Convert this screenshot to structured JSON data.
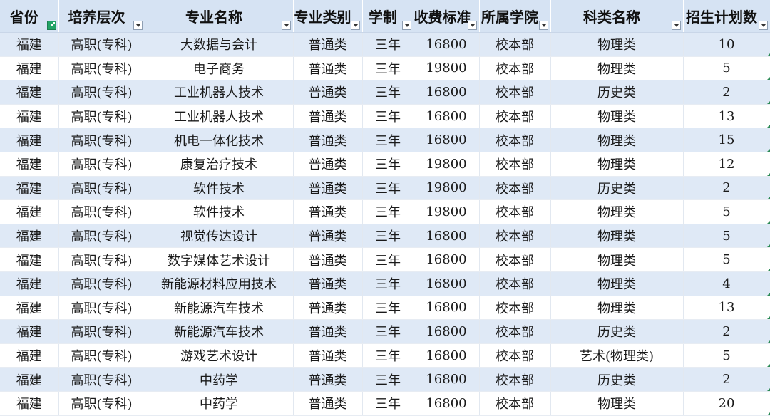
{
  "headers": [
    "省份",
    "培养层次",
    "专业名称",
    "专业类别",
    "学制",
    "收费标准",
    "所属学院",
    "科类名称",
    "招生计划数"
  ],
  "rows": [
    [
      "福建",
      "高职(专科)",
      "大数据与会计",
      "普通类",
      "三年",
      "16800",
      "校本部",
      "物理类",
      "10"
    ],
    [
      "福建",
      "高职(专科)",
      "电子商务",
      "普通类",
      "三年",
      "19800",
      "校本部",
      "物理类",
      "5"
    ],
    [
      "福建",
      "高职(专科)",
      "工业机器人技术",
      "普通类",
      "三年",
      "16800",
      "校本部",
      "历史类",
      "2"
    ],
    [
      "福建",
      "高职(专科)",
      "工业机器人技术",
      "普通类",
      "三年",
      "16800",
      "校本部",
      "物理类",
      "13"
    ],
    [
      "福建",
      "高职(专科)",
      "机电一体化技术",
      "普通类",
      "三年",
      "16800",
      "校本部",
      "物理类",
      "15"
    ],
    [
      "福建",
      "高职(专科)",
      "康复治疗技术",
      "普通类",
      "三年",
      "19800",
      "校本部",
      "物理类",
      "12"
    ],
    [
      "福建",
      "高职(专科)",
      "软件技术",
      "普通类",
      "三年",
      "19800",
      "校本部",
      "历史类",
      "2"
    ],
    [
      "福建",
      "高职(专科)",
      "软件技术",
      "普通类",
      "三年",
      "19800",
      "校本部",
      "物理类",
      "5"
    ],
    [
      "福建",
      "高职(专科)",
      "视觉传达设计",
      "普通类",
      "三年",
      "16800",
      "校本部",
      "物理类",
      "5"
    ],
    [
      "福建",
      "高职(专科)",
      "数字媒体艺术设计",
      "普通类",
      "三年",
      "16800",
      "校本部",
      "物理类",
      "5"
    ],
    [
      "福建",
      "高职(专科)",
      "新能源材料应用技术",
      "普通类",
      "三年",
      "16800",
      "校本部",
      "物理类",
      "4"
    ],
    [
      "福建",
      "高职(专科)",
      "新能源汽车技术",
      "普通类",
      "三年",
      "16800",
      "校本部",
      "物理类",
      "13"
    ],
    [
      "福建",
      "高职(专科)",
      "新能源汽车技术",
      "普通类",
      "三年",
      "16800",
      "校本部",
      "历史类",
      "2"
    ],
    [
      "福建",
      "高职(专科)",
      "游戏艺术设计",
      "普通类",
      "三年",
      "16800",
      "校本部",
      "艺术(物理类)",
      "5"
    ],
    [
      "福建",
      "高职(专科)",
      "中药学",
      "普通类",
      "三年",
      "16800",
      "校本部",
      "历史类",
      "2"
    ],
    [
      "福建",
      "高职(专科)",
      "中药学",
      "普通类",
      "三年",
      "16800",
      "校本部",
      "物理类",
      "20"
    ]
  ],
  "filter": {
    "active_column": "省份",
    "icon": "filter-dropdown-icon",
    "active_icon": "filter-active-icon",
    "active_color": "#21a366"
  },
  "colors": {
    "header_bg": "#d6e3f3",
    "band_row_bg": "#dfe9f6",
    "plain_row_bg": "#ffffff"
  }
}
